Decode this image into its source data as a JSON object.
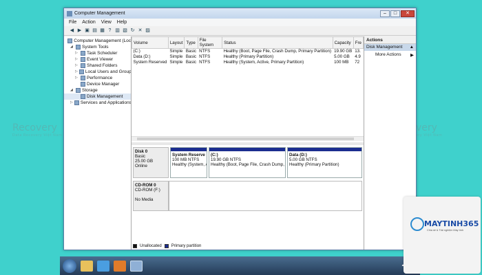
{
  "window": {
    "title": "Computer Management",
    "menu": [
      "File",
      "Action",
      "View",
      "Help"
    ]
  },
  "tree": [
    {
      "label": "Computer Management (Loc",
      "indent": 0,
      "twisty": ""
    },
    {
      "label": "System Tools",
      "indent": 1,
      "twisty": "◢"
    },
    {
      "label": "Task Scheduler",
      "indent": 2,
      "twisty": "▷"
    },
    {
      "label": "Event Viewer",
      "indent": 2,
      "twisty": "▷"
    },
    {
      "label": "Shared Folders",
      "indent": 2,
      "twisty": "▷"
    },
    {
      "label": "Local Users and Group",
      "indent": 2,
      "twisty": "▷"
    },
    {
      "label": "Performance",
      "indent": 2,
      "twisty": "▷"
    },
    {
      "label": "Device Manager",
      "indent": 2,
      "twisty": ""
    },
    {
      "label": "Storage",
      "indent": 1,
      "twisty": "◢"
    },
    {
      "label": "Disk Management",
      "indent": 2,
      "twisty": ""
    },
    {
      "label": "Services and Applications",
      "indent": 1,
      "twisty": "▷"
    }
  ],
  "volumes": {
    "headers": [
      "Volume",
      "Layout",
      "Type",
      "File System",
      "Status",
      "Capacity",
      "Fre"
    ],
    "rows": [
      [
        "(C:)",
        "Simple",
        "Basic",
        "NTFS",
        "Healthy (Boot, Page File, Crash Dump, Primary Partition)",
        "19.90 GB",
        "13."
      ],
      [
        "Data (D:)",
        "Simple",
        "Basic",
        "NTFS",
        "Healthy (Primary Partition)",
        "5.00 GB",
        "4.9"
      ],
      [
        "System Reserved",
        "Simple",
        "Basic",
        "NTFS",
        "Healthy (System, Active, Primary Partition)",
        "100 MB",
        "72"
      ]
    ]
  },
  "disks": [
    {
      "name": "Disk 0",
      "lines": [
        "Basic",
        "25.00 GB",
        "Online"
      ],
      "partitions": [
        {
          "title": "System Reserve",
          "size": "100 MB NTFS",
          "status": "Healthy (System, A"
        },
        {
          "title": "(C:)",
          "size": "19.90 GB NTFS",
          "status": "Healthy (Boot, Page File, Crash Dump, Pri"
        },
        {
          "title": "Data (D:)",
          "size": "5.00 GB NTFS",
          "status": "Healthy (Primary Partition)"
        }
      ]
    },
    {
      "name": "CD-ROM 0",
      "lines": [
        "CD-ROM (F:)",
        "",
        "No Media"
      ],
      "partitions": []
    }
  ],
  "legend": {
    "unallocated": "Unallocated",
    "primary": "Primary partition"
  },
  "actions": {
    "header": "Actions",
    "selected": "Disk Management",
    "items": [
      "More Actions"
    ]
  },
  "watermarks": [
    {
      "text": "Recovery",
      "sub": "Data Recovery Việt Nam"
    }
  ],
  "brand": {
    "name": "MAYTINH365",
    "sub": "Chia sẻ & Trải nghiệm Máy tính"
  },
  "colors": {
    "primary_partition": "#1b2d8f",
    "background": "#3fd1cc"
  }
}
